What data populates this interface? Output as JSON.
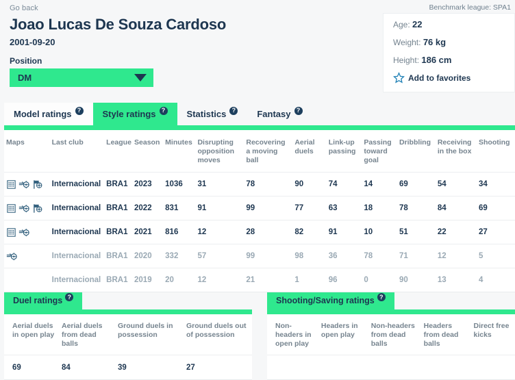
{
  "header": {
    "go_back": "Go back",
    "player_name": "Joao Lucas De Souza Cardoso",
    "date_of_birth": "2001-09-20",
    "position_label": "Position",
    "position_value": "DM",
    "caret_icon": "chevron-down-icon"
  },
  "info_card": {
    "benchmark": "Benchmark league: SPA1",
    "age_label": "Age:",
    "age_value": "22",
    "weight_label": "Weight:",
    "weight_value": "76 kg",
    "height_label": "Height:",
    "height_value": "186 cm",
    "favorites_label": "Add to favorites",
    "star_icon": "star-outline-icon"
  },
  "tabs": [
    {
      "label": "Model ratings",
      "state": "white",
      "help": "?"
    },
    {
      "label": "Style ratings",
      "state": "active",
      "help": "?"
    },
    {
      "label": "Statistics",
      "state": "plain",
      "help": "?"
    },
    {
      "label": "Fantasy",
      "state": "plain",
      "help": "?"
    }
  ],
  "main_table": {
    "headers": [
      "Maps",
      "Last club",
      "League",
      "Season",
      "Minutes",
      "Disrupting opposition moves",
      "Recovering a moving ball",
      "Aerial duels",
      "Link-up passing",
      "Passing toward goal",
      "Dribbling",
      "Receiving in the box",
      "Shooting"
    ],
    "rows": [
      {
        "icons": [
          "heatmap-grid-icon",
          "pass-map-icon",
          "flag-ball-icon"
        ],
        "club": "Internacional",
        "league": "BRA1",
        "season": "2023",
        "minutes": "1036",
        "disrupting_opposition_moves": "31",
        "recovering_a_moving_ball": "78",
        "aerial_duels": "90",
        "link_up_passing": "74",
        "passing_toward_goal": "14",
        "dribbling": "69",
        "receiving_in_the_box": "54",
        "shooting": "34",
        "dim": false
      },
      {
        "icons": [
          "heatmap-grid-icon",
          "pass-map-icon",
          "flag-ball-icon"
        ],
        "club": "Internacional",
        "league": "BRA1",
        "season": "2022",
        "minutes": "831",
        "disrupting_opposition_moves": "91",
        "recovering_a_moving_ball": "99",
        "aerial_duels": "77",
        "link_up_passing": "63",
        "passing_toward_goal": "18",
        "dribbling": "78",
        "receiving_in_the_box": "84",
        "shooting": "69",
        "dim": false
      },
      {
        "icons": [
          "heatmap-grid-icon",
          "pass-map-icon"
        ],
        "club": "Internacional",
        "league": "BRA1",
        "season": "2021",
        "minutes": "816",
        "disrupting_opposition_moves": "12",
        "recovering_a_moving_ball": "28",
        "aerial_duels": "82",
        "link_up_passing": "91",
        "passing_toward_goal": "10",
        "dribbling": "51",
        "receiving_in_the_box": "22",
        "shooting": "27",
        "dim": false
      },
      {
        "icons": [
          "pass-map-icon"
        ],
        "club": "Internacional",
        "league": "BRA1",
        "season": "2020",
        "minutes": "332",
        "disrupting_opposition_moves": "57",
        "recovering_a_moving_ball": "99",
        "aerial_duels": "98",
        "link_up_passing": "36",
        "passing_toward_goal": "78",
        "dribbling": "71",
        "receiving_in_the_box": "12",
        "shooting": "5",
        "dim": true
      },
      {
        "icons": [],
        "club": "Internacional",
        "league": "BRA1",
        "season": "2019",
        "minutes": "20",
        "disrupting_opposition_moves": "12",
        "recovering_a_moving_ball": "21",
        "aerial_duels": "1",
        "link_up_passing": "96",
        "passing_toward_goal": "0",
        "dribbling": "90",
        "receiving_in_the_box": "13",
        "shooting": "4",
        "dim": true
      }
    ]
  },
  "duel_panel": {
    "title": "Duel ratings",
    "help": "?",
    "headers": [
      "Aerial duels in open play",
      "Aerial duels from dead balls",
      "Ground duels in possession",
      "Ground duels out of possession"
    ],
    "values": [
      "69",
      "84",
      "39",
      "27"
    ]
  },
  "shooting_panel": {
    "title": "Shooting/Saving ratings",
    "help": "?",
    "headers": [
      "Non-headers in open play",
      "Headers in open play",
      "Non-headers from dead balls",
      "Headers from dead balls",
      "Direct free kicks"
    ],
    "values": [
      "",
      "",
      "",
      "",
      ""
    ]
  },
  "colors": {
    "accent_green": "#2fe88e",
    "navy": "#1d3650",
    "muted": "#76848f",
    "dim": "#9aa9b4",
    "page_bg": "#f6f7f8",
    "star_blue": "#1c7fb5"
  }
}
